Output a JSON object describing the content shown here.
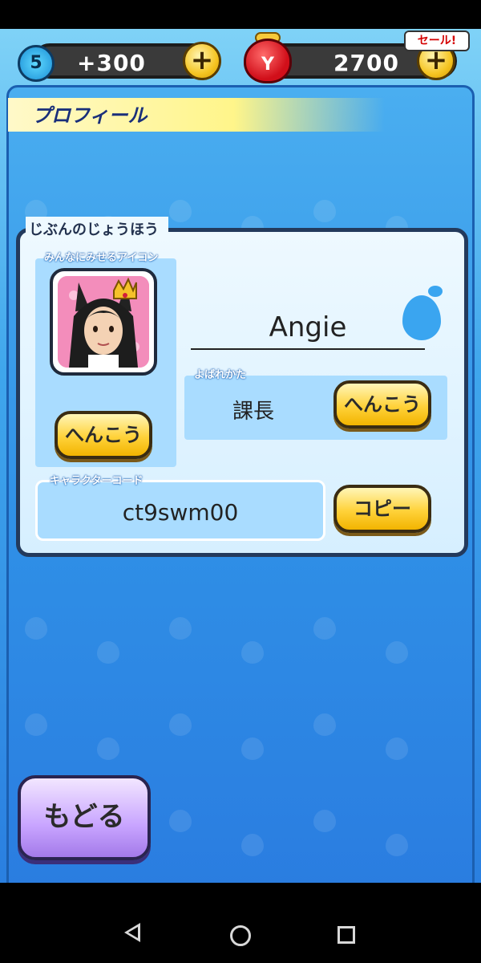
{
  "top_bar": {
    "spirit_count": "5",
    "spirit_bonus": "+300",
    "plus_label": "+",
    "currency_amount": "2700",
    "purse_symbol": "Y",
    "sale_badge": "セール!"
  },
  "header": {
    "title": "プロフィール"
  },
  "profile_card": {
    "section_title": "じぶんのじょうほう",
    "icon_label": "みんなにみせるアイコン",
    "change_icon_button": "へんこう",
    "player_name": "Angie",
    "title_label": "よばれかた",
    "title_value": "課長",
    "change_title_button": "へんこう",
    "code_label": "キャラクターコード",
    "code_value": "ct9swm00",
    "copy_button": "コピー"
  },
  "back_button": "もどる",
  "colors": {
    "accent_yellow": "#ffd23a",
    "panel_blue": "#2f8fe6",
    "back_purple": "#c8a4ff"
  },
  "icons": [
    "spirit-drop-icon",
    "purse-icon",
    "plus-icon",
    "avatar-image",
    "nav-back-icon",
    "nav-home-icon",
    "nav-recents-icon"
  ]
}
